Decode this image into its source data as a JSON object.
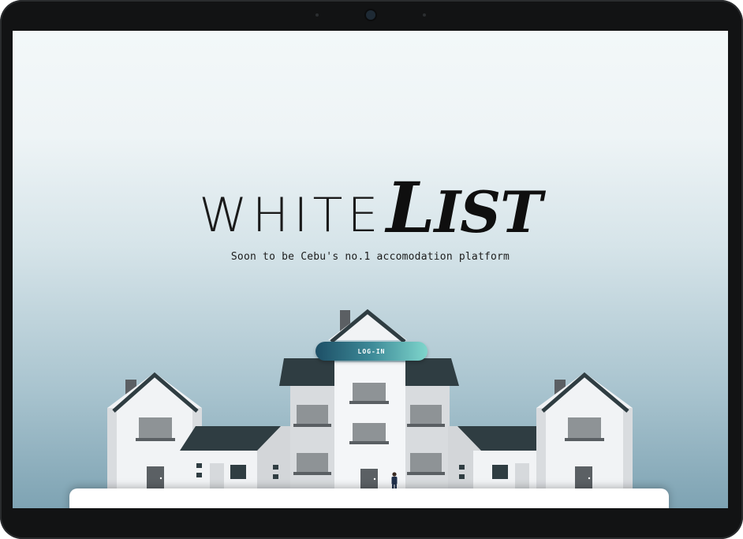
{
  "brand": {
    "logo_light": "WHITE",
    "logo_bold_initial": "L",
    "logo_bold_rest": "IST"
  },
  "hero": {
    "tagline": "Soon to be Cebu's no.1 accomodation platform",
    "login_label": "LOG-IN"
  },
  "colors": {
    "roof": "#2f3d42",
    "wall_light": "#f2f4f6",
    "wall_mid": "#d6d9dc",
    "window": "#8e9396",
    "login_gradient_start": "#1d4f66",
    "login_gradient_end": "#7fd6cc"
  },
  "icons": {
    "person": "person-figure-icon",
    "camera": "front-camera-icon"
  }
}
